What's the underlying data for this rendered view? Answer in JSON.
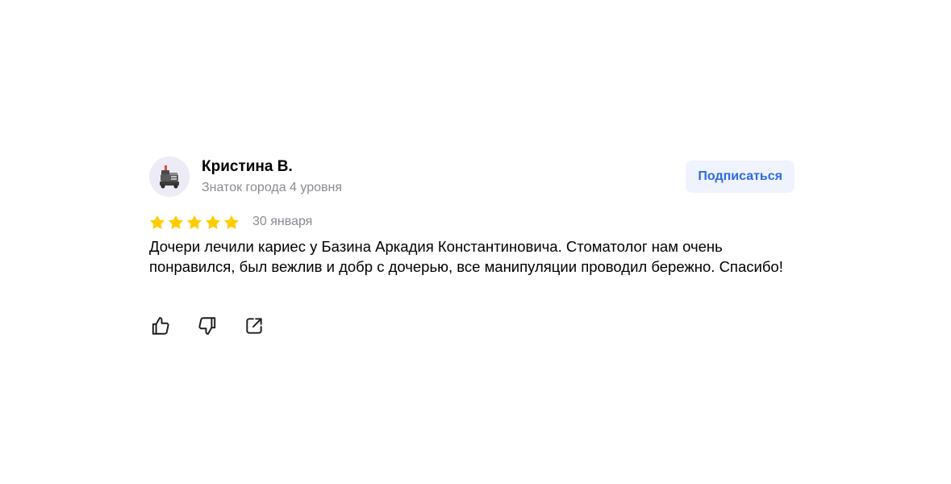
{
  "review": {
    "author": {
      "name": "Кристина В.",
      "rank": "Знаток города 4 уровня",
      "avatar_icon": "robot-vacuum-avatar-icon"
    },
    "subscribe_label": "Подписаться",
    "rating": {
      "value": 5,
      "max": 5
    },
    "date": "30 января",
    "text": "Дочери лечили кариес у Базина Аркадия Константиновича. Стоматолог нам очень понравился, был вежлив и добр с дочерью, все манипуляции проводил бережно. Спасибо!",
    "actions": [
      {
        "name": "like",
        "icon": "thumbs-up-icon"
      },
      {
        "name": "dislike",
        "icon": "thumbs-down-icon"
      },
      {
        "name": "share",
        "icon": "share-icon"
      }
    ]
  },
  "colors": {
    "star": "#FFCC00",
    "accent": "#2F6BE1",
    "subscribe_bg": "#EEF3FD",
    "muted_text": "#888B91",
    "avatar_bg": "#ECEBF6"
  }
}
